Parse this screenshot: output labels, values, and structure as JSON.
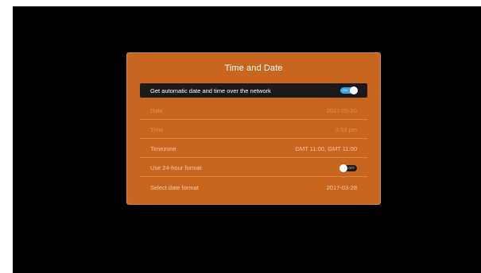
{
  "dialog": {
    "title": "Time and Date",
    "rows": [
      {
        "label": "Get automatic date and time over the network",
        "type": "toggle",
        "toggle_text": "ON",
        "on": true
      },
      {
        "label": "Date",
        "value": "2017-05-20",
        "disabled": true
      },
      {
        "label": "Time",
        "value": "3:58 pm",
        "disabled": true
      },
      {
        "label": "Timezone",
        "value": "GMT 11:00, GMT 11:00"
      },
      {
        "label": "Use 24-hour format",
        "type": "toggle",
        "toggle_text": "OFF",
        "on": false
      },
      {
        "label": "Select date format",
        "value": "2017-03-28"
      }
    ]
  },
  "colors": {
    "dialog_bg": "#c8651f",
    "focus_bg": "#1a1a1a",
    "toggle_on": "#3aa3e3",
    "screen_bg": "#000000"
  }
}
